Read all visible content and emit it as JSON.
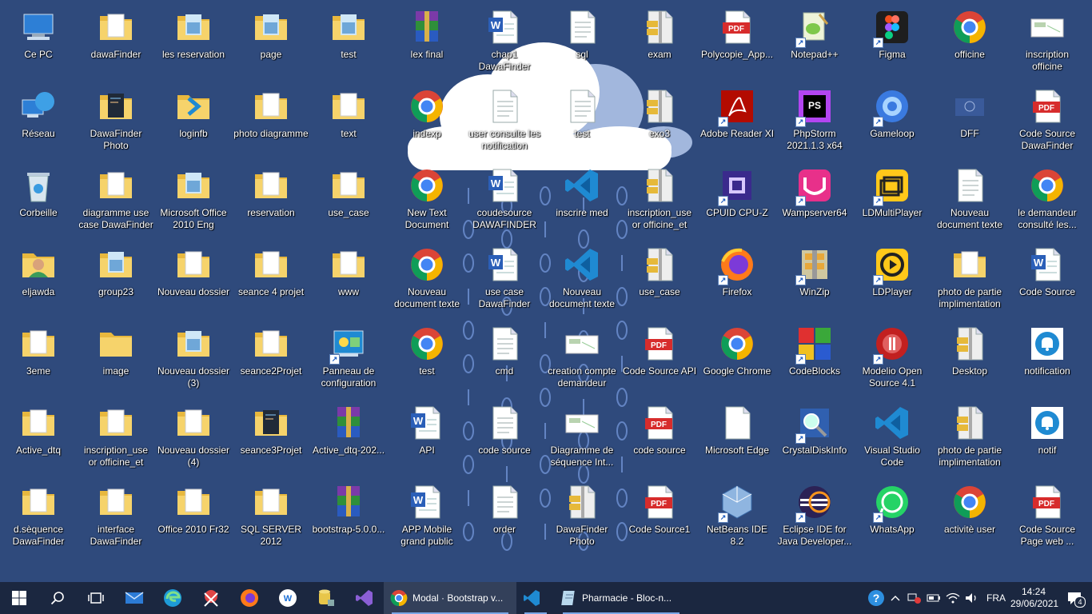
{
  "desktop": {
    "icons": [
      {
        "label": "Ce PC",
        "type": "pc"
      },
      {
        "label": "Réseau",
        "type": "network"
      },
      {
        "label": "Corbeille",
        "type": "bin"
      },
      {
        "label": "eljawda",
        "type": "user"
      },
      {
        "label": "3eme",
        "type": "folderdoc"
      },
      {
        "label": "Active_dtq",
        "type": "folderdoc"
      },
      {
        "label": "d.sèquence DawaFinder",
        "type": "folderdoc"
      },
      {
        "label": "dawaFinder",
        "type": "folderdoc"
      },
      {
        "label": "DawaFinder Photo",
        "type": "folderdark"
      },
      {
        "label": "diagramme use case DawaFinder",
        "type": "folderdoc"
      },
      {
        "label": "group23",
        "type": "folderimg"
      },
      {
        "label": "image",
        "type": "folder"
      },
      {
        "label": "inscription_use or officine_et con...",
        "type": "folderdoc"
      },
      {
        "label": "interface DawaFinder",
        "type": "folderdoc"
      },
      {
        "label": "les reservation",
        "type": "folderimg"
      },
      {
        "label": "loginfb",
        "type": "folderblue"
      },
      {
        "label": "Microsoft Office 2010 Eng",
        "type": "folderimg"
      },
      {
        "label": "Nouveau dossier",
        "type": "folderdoc"
      },
      {
        "label": "Nouveau dossier (3)",
        "type": "folderimg"
      },
      {
        "label": "Nouveau dossier (4)",
        "type": "folderdoc"
      },
      {
        "label": "Office 2010 Fr32",
        "type": "folderdoc"
      },
      {
        "label": "page",
        "type": "folderimg"
      },
      {
        "label": "photo diagramme",
        "type": "folderdoc"
      },
      {
        "label": "reservation",
        "type": "folderdoc"
      },
      {
        "label": "seance 4 projet",
        "type": "folderdoc"
      },
      {
        "label": "seance2Projet",
        "type": "folderdoc"
      },
      {
        "label": "seance3Projet",
        "type": "folderdark"
      },
      {
        "label": "SQL SERVER 2012",
        "type": "folderdoc"
      },
      {
        "label": "test",
        "type": "folderimg"
      },
      {
        "label": "text",
        "type": "folderdoc"
      },
      {
        "label": "use_case",
        "type": "folderdoc"
      },
      {
        "label": "www",
        "type": "folderdoc"
      },
      {
        "label": "Panneau de configuration",
        "type": "control"
      },
      {
        "label": "Active_dtq-202...",
        "type": "rar"
      },
      {
        "label": "bootstrap-5.0.0...",
        "type": "rar"
      },
      {
        "label": "lex final",
        "type": "rar"
      },
      {
        "label": "indexp",
        "type": "chrome"
      },
      {
        "label": "New Text Document",
        "type": "chrome"
      },
      {
        "label": "Nouveau document texte",
        "type": "chrome"
      },
      {
        "label": "test",
        "type": "chrome"
      },
      {
        "label": "API",
        "type": "word"
      },
      {
        "label": "APP Mobile grand public",
        "type": "word"
      },
      {
        "label": "chap1 DawaFinder",
        "type": "word"
      },
      {
        "label": "user consulte les notification",
        "type": "txt"
      },
      {
        "label": "coudesource DAWAFINDER",
        "type": "word"
      },
      {
        "label": "use case DawaFinder",
        "type": "word"
      },
      {
        "label": "cmd",
        "type": "txt"
      },
      {
        "label": "code source",
        "type": "txt"
      },
      {
        "label": "order",
        "type": "txt"
      },
      {
        "label": "sql",
        "type": "txt"
      },
      {
        "label": "test",
        "type": "txt"
      },
      {
        "label": "inscrire med",
        "type": "vscode"
      },
      {
        "label": "Nouveau document texte",
        "type": "vscode"
      },
      {
        "label": "creation compte demandeur",
        "type": "image"
      },
      {
        "label": "Diagramme de séquence Int...",
        "type": "image"
      },
      {
        "label": "DawaFinder Photo",
        "type": "zip"
      },
      {
        "label": "exam",
        "type": "zip"
      },
      {
        "label": "exo3",
        "type": "zip"
      },
      {
        "label": "inscription_use or officine_et con...",
        "type": "zip"
      },
      {
        "label": "use_case",
        "type": "zip"
      },
      {
        "label": "Code Source API",
        "type": "pdf"
      },
      {
        "label": "code source",
        "type": "pdf"
      },
      {
        "label": "Code Source1",
        "type": "pdf"
      },
      {
        "label": "Polycopie_App...",
        "type": "pdf"
      },
      {
        "label": "Adobe Reader XI",
        "type": "adobe"
      },
      {
        "label": "CPUID CPU-Z",
        "type": "cpuz"
      },
      {
        "label": "Firefox",
        "type": "firefox"
      },
      {
        "label": "Google Chrome",
        "type": "chrome"
      },
      {
        "label": "Microsoft Edge",
        "type": "blank"
      },
      {
        "label": "NetBeans IDE 8.2",
        "type": "netbeans"
      },
      {
        "label": "Notepad++",
        "type": "notepad"
      },
      {
        "label": "PhpStorm 2021.1.3 x64",
        "type": "phpstorm"
      },
      {
        "label": "Wampserver64",
        "type": "wamp"
      },
      {
        "label": "WinZip",
        "type": "winzip"
      },
      {
        "label": "CodeBlocks",
        "type": "codeblocks"
      },
      {
        "label": "CrystalDiskInfo",
        "type": "crystal"
      },
      {
        "label": "Eclipse IDE for Java Developer...",
        "type": "eclipse"
      },
      {
        "label": "Figma",
        "type": "figma"
      },
      {
        "label": "Gameloop",
        "type": "gameloop"
      },
      {
        "label": "LDMultiPlayer",
        "type": "ldmulti"
      },
      {
        "label": "LDPlayer",
        "type": "ldplayer"
      },
      {
        "label": "Modelio Open Source 4.1",
        "type": "modelio"
      },
      {
        "label": "Visual Studio Code",
        "type": "vscode"
      },
      {
        "label": "WhatsApp",
        "type": "whatsapp"
      },
      {
        "label": "officine",
        "type": "chrome"
      },
      {
        "label": "DFF",
        "type": "dff"
      },
      {
        "label": "Nouveau document texte",
        "type": "txt"
      },
      {
        "label": "photo de partie implimentation",
        "type": "folderdoc"
      },
      {
        "label": "Desktop",
        "type": "zip"
      },
      {
        "label": "photo de partie implimentation",
        "type": "zip"
      },
      {
        "label": "activitè user",
        "type": "chrome"
      },
      {
        "label": "inscription officine",
        "type": "image"
      },
      {
        "label": "Code Source DawaFinder",
        "type": "pdf"
      },
      {
        "label": "le demandeur consulté les...",
        "type": "chrome"
      },
      {
        "label": "Code Source",
        "type": "word"
      },
      {
        "label": "notification",
        "type": "bell"
      },
      {
        "label": "notif",
        "type": "bell"
      },
      {
        "label": "Code Source Page web ...",
        "type": "pdf"
      }
    ]
  },
  "taskbar": {
    "apps": [
      {
        "label": "Modal · Bootstrap v...",
        "icon": "chrome-icon"
      },
      {
        "label": "",
        "icon": "vscode-icon"
      },
      {
        "label": "Pharmacie - Bloc-n...",
        "icon": "notepad-icon"
      }
    ],
    "tray": {
      "language": "FRA",
      "time": "14:24",
      "date": "29/06/2021",
      "notification_count": "4"
    }
  }
}
